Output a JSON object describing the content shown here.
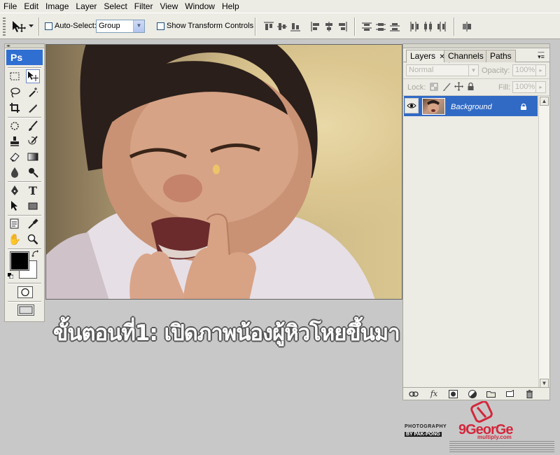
{
  "menu": [
    "File",
    "Edit",
    "Image",
    "Layer",
    "Select",
    "Filter",
    "View",
    "Window",
    "Help"
  ],
  "options_bar": {
    "auto_select_label": "Auto-Select:",
    "auto_select_value": "Group",
    "show_transform_label": "Show Transform Controls"
  },
  "tools": {
    "logo": "Ps",
    "items": [
      "marquee-icon",
      "move-icon",
      "lasso-icon",
      "magic-wand-icon",
      "crop-icon",
      "slice-icon",
      "healing-brush-icon",
      "brush-icon",
      "clone-stamp-icon",
      "history-brush-icon",
      "eraser-icon",
      "gradient-icon",
      "blur-icon",
      "dodge-icon",
      "pen-icon",
      "type-icon",
      "path-selection-icon",
      "rectangle-icon",
      "notes-icon",
      "eyedropper-icon",
      "hand-icon",
      "zoom-icon"
    ],
    "foreground_color": "#000000",
    "background_color": "#ffffff"
  },
  "canvas": {
    "subject": "photo-of-crying-toddler"
  },
  "caption": "ขั้นตอนที่1: เปิดภาพน้องผู้หิวโหยขึ้นมา",
  "layers_panel": {
    "tabs": [
      "Layers",
      "Channels",
      "Paths"
    ],
    "active_tab": "Layers",
    "blend_mode": "Normal",
    "opacity_label": "Opacity:",
    "opacity_value": "100%",
    "lock_label": "Lock:",
    "fill_label": "Fill:",
    "fill_value": "100%",
    "layers": [
      {
        "name": "Background",
        "visible": true,
        "locked": true,
        "selected": true
      }
    ]
  },
  "watermarks": {
    "left_line1": "PHOTOGRAPHY",
    "left_line2": "BY PAK-PONG",
    "right_brand": "9GeorGe",
    "right_sub": "multiply.com"
  },
  "colors": {
    "selection": "#316ac5",
    "ps_logo": "#2f6fd2",
    "watermark_red": "#d2283c"
  }
}
